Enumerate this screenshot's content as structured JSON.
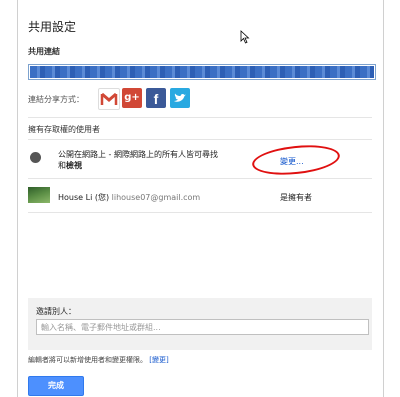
{
  "dialog": {
    "title": "共用設定",
    "link_section_label": "共用連結",
    "share_via_label": "連結分享方式：",
    "social": [
      {
        "name": "gmail",
        "icon": "gmail-icon",
        "color": "#d14836"
      },
      {
        "name": "google-plus",
        "icon": "google-plus-icon",
        "label": "g+",
        "color": "#d14836"
      },
      {
        "name": "facebook",
        "icon": "facebook-icon",
        "label": "f",
        "color": "#3b5998"
      },
      {
        "name": "twitter",
        "icon": "twitter-icon",
        "color": "#29a9e1"
      }
    ],
    "permissions_title": "擁有存取權的使用者",
    "public_row": {
      "line1": "公開在網路上 - 網際網路上的所有人皆可尋找",
      "line2_prefix": "和",
      "line2_bold": "檢視",
      "change_label": "變更..."
    },
    "owner_row": {
      "name": "House Li (您)",
      "email": "lihouse07@gmail.com",
      "role": "是擁有者"
    },
    "invite": {
      "label": "邀請別人：",
      "placeholder": "輸入名稱、電子郵件地址或群組..."
    },
    "footnote_text": "編輯者將可以新增使用者和變更權限。",
    "footnote_link": "[變更]",
    "done_label": "完成",
    "colors": {
      "link_blue": "#15c",
      "primary_button": "#4d90fe",
      "highlight_ellipse": "#e01010"
    }
  }
}
